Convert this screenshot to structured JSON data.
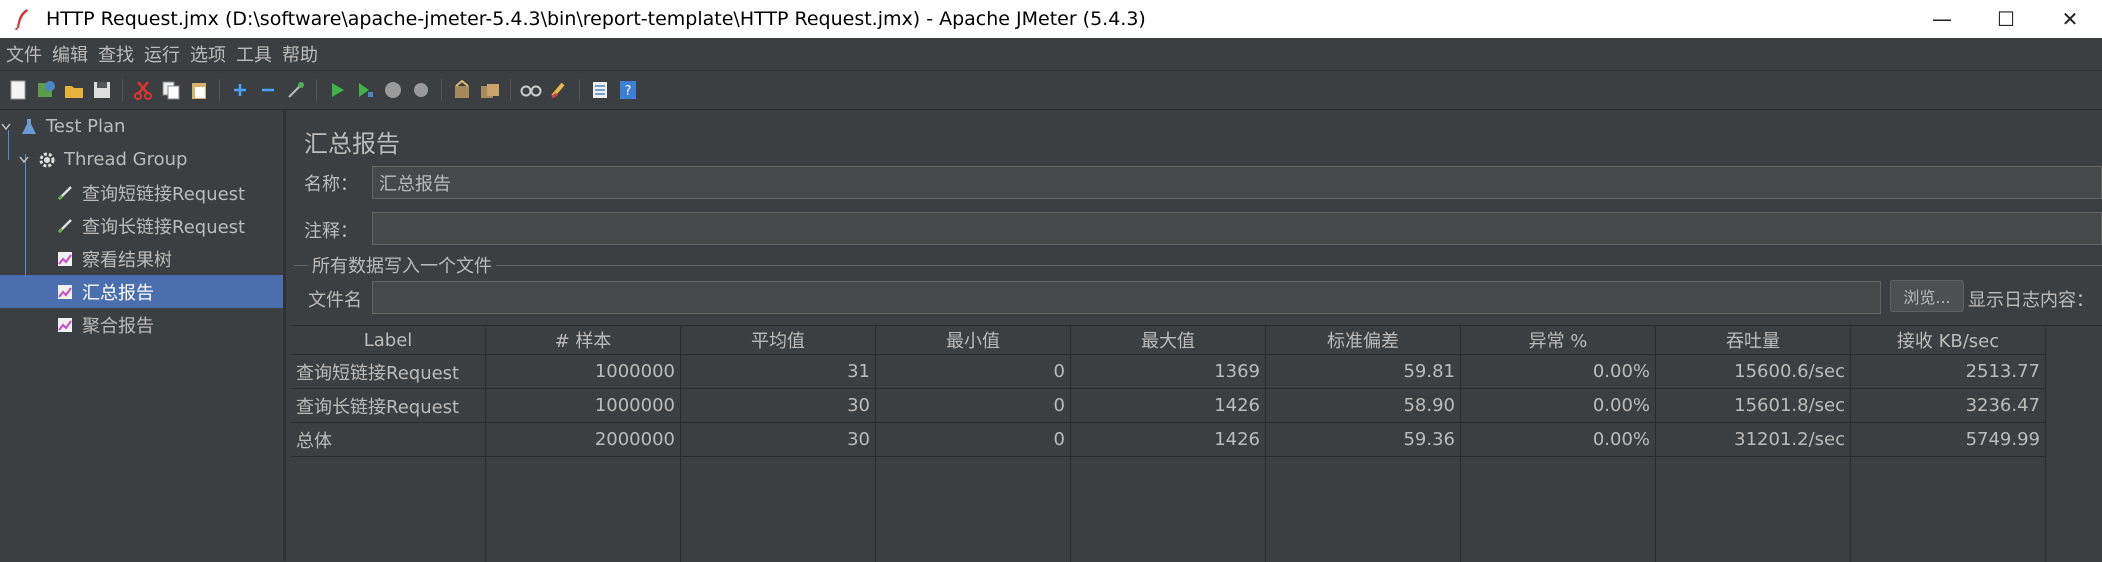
{
  "window": {
    "title": "HTTP Request.jmx (D:\\software\\apache-jmeter-5.4.3\\bin\\report-template\\HTTP Request.jmx) - Apache JMeter (5.4.3)",
    "app_icon": "jmeter-feather-icon",
    "minimize": "—",
    "maximize": "☐",
    "close": "✕"
  },
  "menu": [
    "文件",
    "编辑",
    "查找",
    "运行",
    "选项",
    "工具",
    "帮助"
  ],
  "toolbar": [
    "new-icon",
    "templates-icon",
    "open-icon",
    "save-icon",
    "cut-icon",
    "copy-icon",
    "paste-icon",
    "expand-icon",
    "collapse-icon",
    "toggle-icon",
    "start-icon",
    "start-no-pause-icon",
    "stop-icon",
    "shutdown-icon",
    "clear-icon",
    "clear-all-icon",
    "search-icon",
    "reset-search-icon",
    "function-helper-icon",
    "help-icon"
  ],
  "tree": {
    "test_plan": "Test Plan",
    "thread_group": "Thread Group",
    "items": [
      {
        "label": "查询短链接Request",
        "icon": "sampler-icon"
      },
      {
        "label": "查询长链接Request",
        "icon": "sampler-icon"
      },
      {
        "label": "察看结果树",
        "icon": "listener-icon"
      },
      {
        "label": "汇总报告",
        "icon": "listener-icon",
        "selected": true
      },
      {
        "label": "聚合报告",
        "icon": "listener-icon"
      }
    ]
  },
  "panel": {
    "title": "汇总报告",
    "name_label": "名称：",
    "name_value": "汇总报告",
    "comment_label": "注释：",
    "comment_value": "",
    "group_title": "所有数据写入一个文件",
    "filename_label": "文件名",
    "filename_value": "",
    "browse": "浏览...",
    "log_label": "显示日志内容："
  },
  "table": {
    "columns": [
      "Label",
      "# 样本",
      "平均值",
      "最小值",
      "最大值",
      "标准偏差",
      "异常 %",
      "吞吐量",
      "接收 KB/sec"
    ],
    "rows": [
      [
        "查询短链接Request",
        "1000000",
        "31",
        "0",
        "1369",
        "59.81",
        "0.00%",
        "15600.6/sec",
        "2513.77"
      ],
      [
        "查询长链接Request",
        "1000000",
        "30",
        "0",
        "1426",
        "58.90",
        "0.00%",
        "15601.8/sec",
        "3236.47"
      ],
      [
        "总体",
        "2000000",
        "30",
        "0",
        "1426",
        "59.36",
        "0.00%",
        "31201.2/sec",
        "5749.99"
      ]
    ]
  }
}
